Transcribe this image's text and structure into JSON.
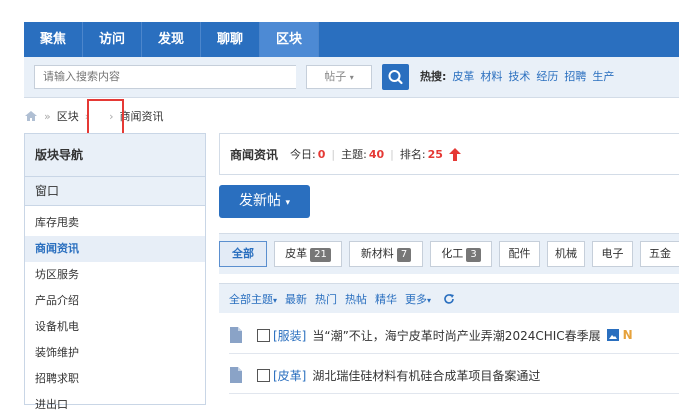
{
  "topnav": {
    "items": [
      "聚焦",
      "访问",
      "发现",
      "聊聊",
      "区块"
    ]
  },
  "search": {
    "placeholder": "请输入搜索内容",
    "select_value": "帖子"
  },
  "hot": {
    "label": "热搜:",
    "tags": [
      "皮革",
      "材料",
      "技术",
      "经历",
      "招聘",
      "生产"
    ]
  },
  "breadcrumb": {
    "items": [
      "区块",
      "",
      "商闻资讯"
    ]
  },
  "sidebar": {
    "title": "版块导航",
    "window_label": "窗口",
    "items": [
      "库存甩卖",
      "商闻资讯",
      "坊区服务",
      "产品介绍",
      "设备机电",
      "装饰维护",
      "招聘求职",
      "进出口"
    ]
  },
  "board": {
    "name": "商闻资讯",
    "today_label": "今日:",
    "today_value": "0",
    "topics_label": "主题:",
    "topics_value": "40",
    "rank_label": "排名:",
    "rank_value": "25"
  },
  "new_post_label": "发新帖",
  "tabs": [
    {
      "label": "全部",
      "count": ""
    },
    {
      "label": "皮革",
      "count": "21"
    },
    {
      "label": "新材料",
      "count": "7"
    },
    {
      "label": "化工",
      "count": "3"
    },
    {
      "label": "配件",
      "count": ""
    },
    {
      "label": "机械",
      "count": ""
    },
    {
      "label": "电子",
      "count": ""
    },
    {
      "label": "五金",
      "count": ""
    }
  ],
  "filters": [
    "全部主题",
    "最新",
    "热门",
    "热帖",
    "精华",
    "更多"
  ],
  "threads": [
    {
      "category": "[服装]",
      "title": "当“潮”不让，海宁皮革时尚产业弄潮2024CHIC春季展",
      "flag": "N"
    },
    {
      "category": "[皮革]",
      "title": "湖北瑞佳硅材料有机硅合成革项目备案通过",
      "flag": ""
    }
  ],
  "colors": {
    "primary": "#2a6fbf",
    "accent_red": "#e53935",
    "panel_bg": "#e9f0f8"
  }
}
